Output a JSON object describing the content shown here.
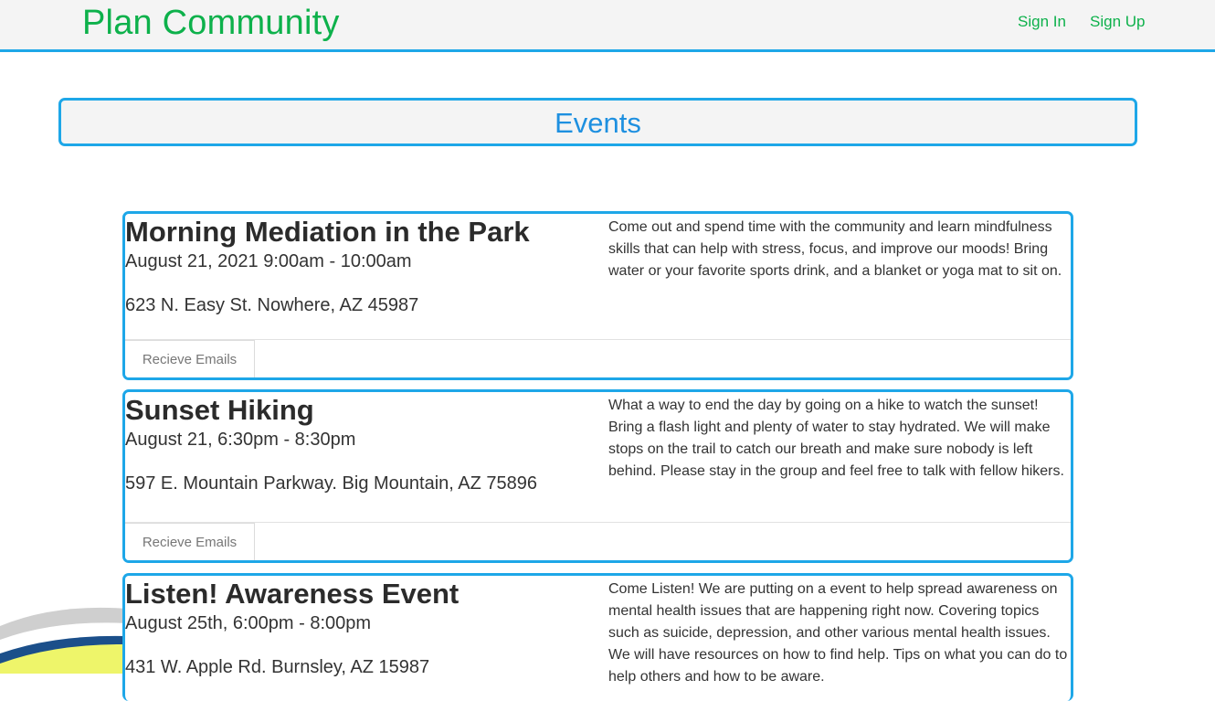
{
  "nav": {
    "brand": "Plan Community",
    "sign_in": "Sign In",
    "sign_up": "Sign Up"
  },
  "page": {
    "heading": "Events"
  },
  "events": [
    {
      "title": "Morning Mediation in the Park",
      "date": "August 21, 2021 9:00am - 10:00am",
      "address": "623 N. Easy St. Nowhere, AZ 45987",
      "description": "Come out and spend time with the community and learn mindfulness skills that can help with stress, focus, and improve our moods! Bring water or your favorite sports drink, and a blanket or yoga mat to sit on.",
      "button": "Recieve Emails"
    },
    {
      "title": "Sunset Hiking",
      "date": "August 21, 6:30pm - 8:30pm",
      "address": "597 E. Mountain Parkway. Big Mountain, AZ 75896",
      "description": "What a way to end the day by going on a hike to watch the sunset! Bring a flash light and plenty of water to stay hydrated. We will make stops on the trail to catch our breath and make sure nobody is left behind. Please stay in the group and feel free to talk with fellow hikers.",
      "button": "Recieve Emails"
    },
    {
      "title": "Listen! Awareness Event",
      "date": "August 25th, 6:00pm - 8:00pm",
      "address": "431 W. Apple Rd. Burnsley, AZ 15987",
      "description": "Come Listen! We are putting on a event to help spread awareness on mental health issues that are happening right now. Covering topics such as suicide, depression, and other various mental health issues. We will have resources on how to find help. Tips on what you can do to help others and how to be aware."
    }
  ],
  "colors": {
    "brand_green": "#0db14b",
    "accent_blue": "#1ea7e8",
    "heading_blue": "#1e90e0"
  }
}
